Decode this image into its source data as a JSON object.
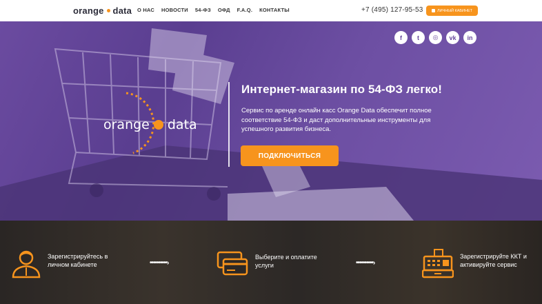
{
  "header": {
    "logo_left": "orange",
    "logo_right": "data",
    "nav": [
      "О НАС",
      "НОВОСТИ",
      "54-ФЗ",
      "ОФД",
      "F.A.Q.",
      "КОНТАКТЫ"
    ],
    "phone": "+7 (495) 127-95-53",
    "cabinet_label": "ЛИЧНЫЙ КАБИНЕТ"
  },
  "social": [
    {
      "icon": "facebook-icon",
      "glyph": "f"
    },
    {
      "icon": "twitter-icon",
      "glyph": "t"
    },
    {
      "icon": "instagram-icon",
      "glyph": "◎"
    },
    {
      "icon": "vk-icon",
      "glyph": "vk"
    },
    {
      "icon": "linkedin-icon",
      "glyph": "in"
    }
  ],
  "hero": {
    "logo_left": "orange",
    "logo_right": "data",
    "title": "Интернет-магазин по 54-ФЗ легко!",
    "text": "Сервис по аренде онлайн касс Orange Data обеспечит полное соответствие 54-ФЗ и даст дополнительные инструменты для успешного развития бизнеса.",
    "cta": "ПОДКЛЮЧИТЬСЯ"
  },
  "steps": [
    {
      "icon": "user-icon",
      "line1": "Зарегистрируйтесь в",
      "line2": "личном кабинете"
    },
    {
      "icon": "payment-card-icon",
      "line1": "Выберите и оплатите",
      "line2": "услуги"
    },
    {
      "icon": "cash-register-icon",
      "line1": "Зарегистрируйте ККТ и",
      "line2": "активируйте сервис"
    }
  ],
  "step_arrow": "••••••••••›",
  "colors": {
    "accent": "#f7941d",
    "hero_purple": "#6b4ba0",
    "steps_bg": "#2c2826"
  }
}
